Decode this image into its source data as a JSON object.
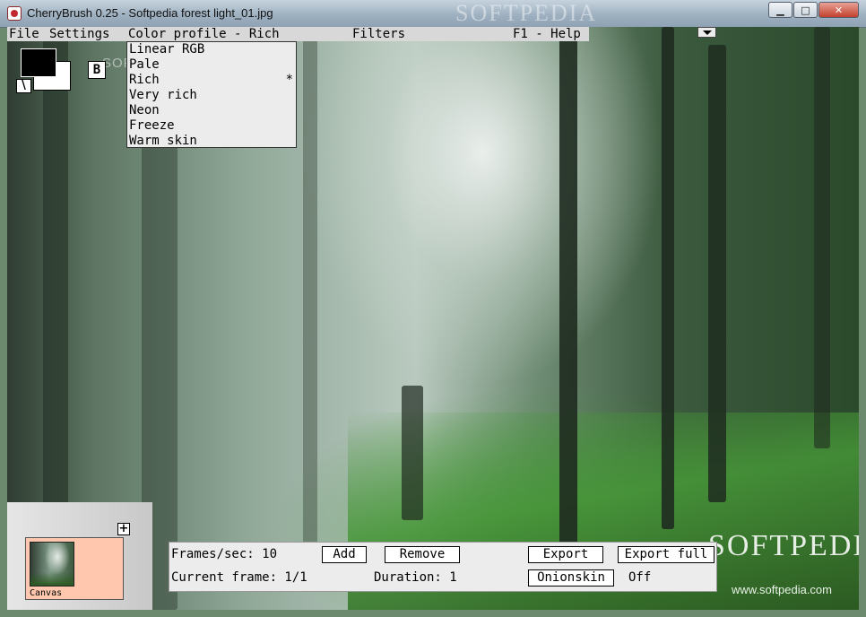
{
  "window": {
    "title": "CherryBrush 0.25 - Softpedia forest light_01.jpg",
    "minimize_glyph": "▁",
    "maximize_glyph": "□",
    "close_glyph": "✕"
  },
  "menubar": {
    "items": [
      "File",
      "Settings",
      "Color profile - Rich",
      "Filters",
      "F1 - Help"
    ]
  },
  "color_profile_menu": {
    "items": [
      {
        "label": "Linear RGB",
        "mark": ""
      },
      {
        "label": "Pale",
        "mark": ""
      },
      {
        "label": "Rich",
        "mark": "*"
      },
      {
        "label": "Very rich",
        "mark": ""
      },
      {
        "label": "Neon",
        "mark": ""
      },
      {
        "label": "Freeze",
        "mark": ""
      },
      {
        "label": "Warm skin",
        "mark": ""
      }
    ]
  },
  "tools": {
    "foreground_color": "#000000",
    "background_color": "#ffffff",
    "swap_glyph": "\\",
    "b_label": "B"
  },
  "layers": {
    "add_glyph": "+",
    "items": [
      {
        "label": "Canvas"
      }
    ]
  },
  "animation": {
    "fps_label": "Frames/sec: 10",
    "add_label": "Add",
    "remove_label": "Remove",
    "export_label": "Export",
    "export_full_label": "Export full",
    "current_frame_label": "Current frame: 1/1",
    "duration_label": "Duration: 1",
    "onionskin_label": "Onionskin",
    "onionskin_state": "Off"
  },
  "watermark": {
    "brand": "SOFTPEDIA",
    "url": "www.softpedia.com"
  }
}
